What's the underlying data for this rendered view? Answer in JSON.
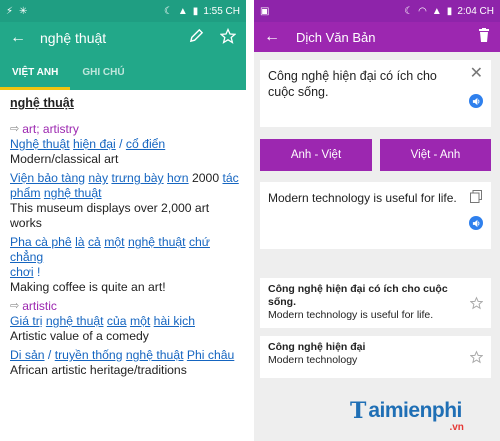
{
  "left": {
    "status_time": "1:55 CH",
    "title": "nghệ thuật",
    "tabs": [
      "VIỆT ANH",
      "GHI CHÚ"
    ],
    "headword": "nghệ thuật",
    "senses": [
      {
        "label": "art; artistry",
        "examples": [
          {
            "vi": [
              "Nghệ thuật",
              " ",
              "hiện đại",
              " / ",
              "cổ điển"
            ],
            "en": "Modern/classical art"
          },
          {
            "vi": [
              "Viện bảo tàng",
              " ",
              "này",
              " ",
              "trưng bày",
              " ",
              "hơn",
              " 2000 ",
              "tác",
              " "
            ],
            "vi2": [
              "phẩm",
              " ",
              "nghệ thuật"
            ],
            "en": "This museum displays over 2,000 art works"
          },
          {
            "vi": [
              "Pha cà phê",
              " ",
              "là",
              " ",
              "cả",
              " ",
              "một",
              " ",
              "nghệ thuật",
              " ",
              "chứ",
              " ",
              "chẳng"
            ],
            "vi2": [
              "chơi",
              " !"
            ],
            "en": "Making coffee is quite an art!"
          }
        ]
      },
      {
        "label": "artistic",
        "examples": [
          {
            "vi": [
              "Giá trị",
              " ",
              "nghệ thuật",
              " ",
              "của",
              " ",
              "một",
              " ",
              "hài kịch"
            ],
            "en": "Artistic value of a comedy"
          },
          {
            "vi": [
              "Di sản",
              " / ",
              "truyền thống",
              " ",
              "nghệ thuật",
              " ",
              "Phi châu"
            ],
            "en": "African artistic heritage/traditions"
          }
        ]
      }
    ],
    "accent": "#22a889"
  },
  "right": {
    "status_time": "2:04 CH",
    "title": "Dịch Văn Bản",
    "input_text": "Công nghệ hiện đại có ích cho cuộc sống.",
    "btn_av": "Anh - Việt",
    "btn_va": "Việt - Anh",
    "result_text": "Modern technology is useful for life.",
    "history": [
      {
        "vi": "Công nghệ hiện đại có ích cho cuộc sống.",
        "en": "Modern technology is useful for life."
      },
      {
        "vi": "Công nghệ hiện đại",
        "en": "Modern technology"
      }
    ],
    "accent": "#9c27b0"
  },
  "watermark": {
    "brand": "aimienphi",
    "initial": "T",
    "tld": ".vn"
  }
}
